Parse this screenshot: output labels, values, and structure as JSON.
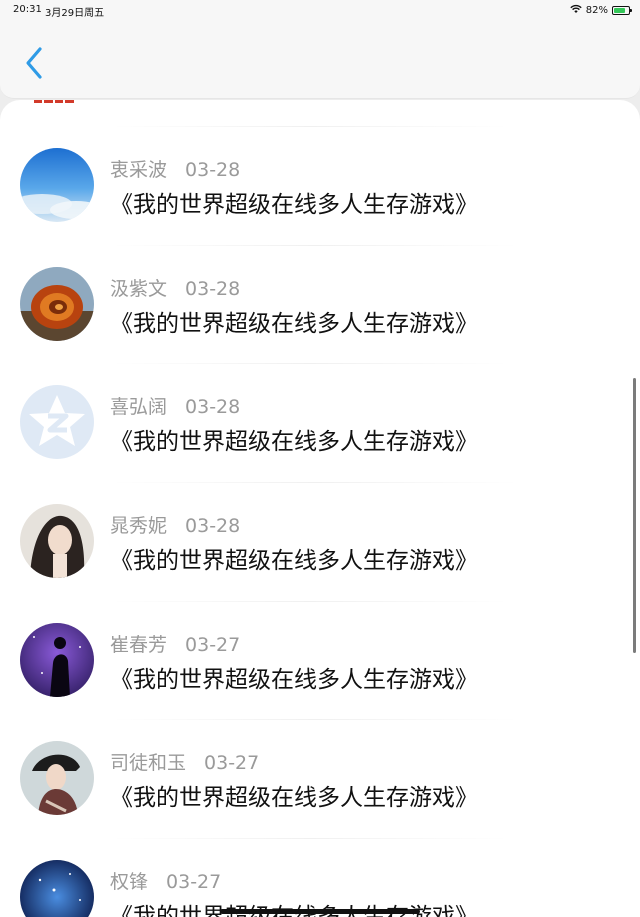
{
  "status_bar": {
    "time": "20:31",
    "date": "3月29日周五",
    "battery": "82%",
    "battery_level": 0.82
  },
  "header": {
    "back_icon": "chevron-left-icon",
    "accent": "#2f9be6"
  },
  "comments": [
    {
      "name": "衷采波",
      "date": "03-28",
      "text": "《我的世界超级在线多人生存游戏》",
      "avatar": "sky"
    },
    {
      "name": "汲紫文",
      "date": "03-28",
      "text": "《我的世界超级在线多人生存游戏》",
      "avatar": "ammonite"
    },
    {
      "name": "喜弘阔",
      "date": "03-28",
      "text": "《我的世界超级在线多人生存游戏》",
      "avatar": "qzone-default"
    },
    {
      "name": "晁秀妮",
      "date": "03-28",
      "text": "《我的世界超级在线多人生存游戏》",
      "avatar": "portrait"
    },
    {
      "name": "崔春芳",
      "date": "03-27",
      "text": "《我的世界超级在线多人生存游戏》",
      "avatar": "silhouette"
    },
    {
      "name": "司徒和玉",
      "date": "03-27",
      "text": "《我的世界超级在线多人生存游戏》",
      "avatar": "portrait-hat"
    },
    {
      "name": "权锋",
      "date": "03-27",
      "text": "《我的世界超级在线多人生存游戏》",
      "avatar": "galaxy"
    }
  ]
}
